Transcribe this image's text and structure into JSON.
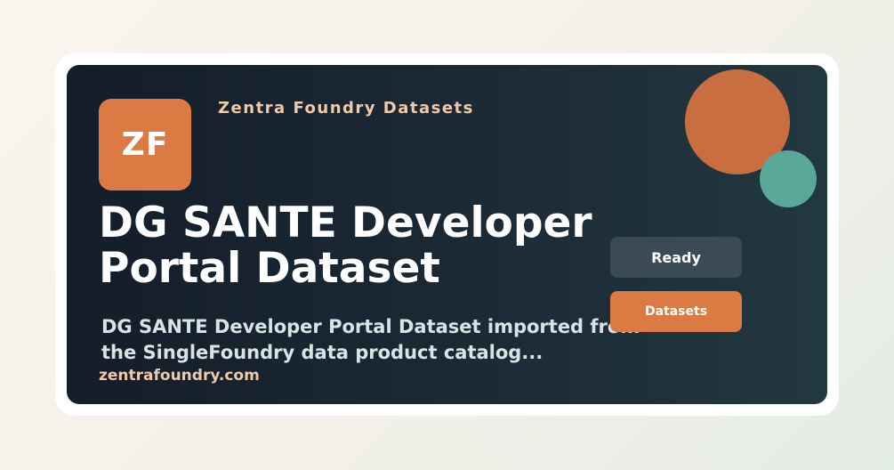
{
  "logo": {
    "initials": "ZF"
  },
  "brand": {
    "name": "Zentra Foundry Datasets"
  },
  "dataset": {
    "title": "DG SANTE Developer Portal Dataset",
    "description": "DG SANTE Developer Portal Dataset imported from the SingleFoundry data product catalog...",
    "url": "zentrafoundry.com"
  },
  "actions": {
    "status_label": "Ready",
    "category_label": "Datasets"
  },
  "colors": {
    "accent_orange": "#dc7a44",
    "accent_teal": "#5aa89a",
    "card_dark": "#141d2a",
    "status_button": "#3b4b55"
  }
}
